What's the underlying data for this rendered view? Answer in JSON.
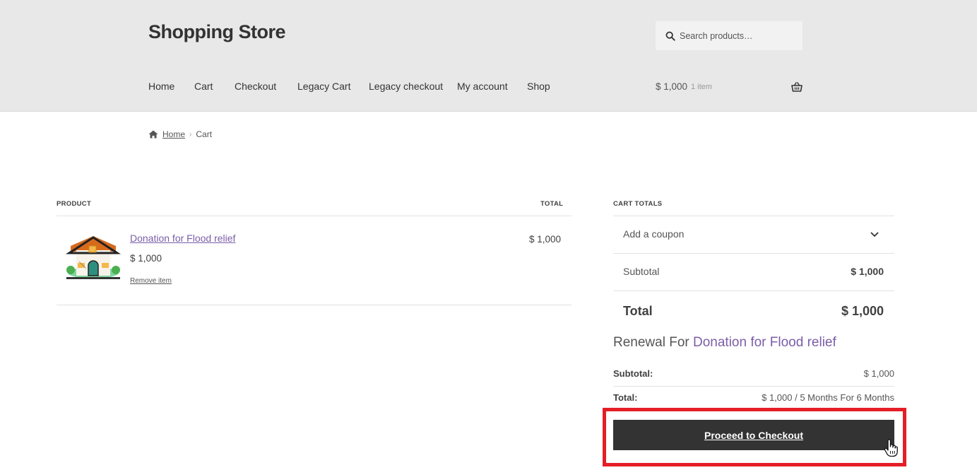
{
  "header": {
    "site_title": "Shopping Store",
    "search": {
      "placeholder": "Search products…"
    },
    "nav": [
      "Home",
      "Cart",
      "Checkout",
      "Legacy Cart",
      "Legacy checkout",
      "My account",
      "Shop"
    ],
    "mini_cart": {
      "amount": "$ 1,000",
      "count": "1 item"
    }
  },
  "breadcrumb": {
    "home": "Home",
    "current": "Cart"
  },
  "cart_table": {
    "headers": {
      "product": "PRODUCT",
      "total": "TOTAL"
    },
    "items": [
      {
        "name": "Donation for Flood relief",
        "price": "$ 1,000",
        "remove": "Remove item",
        "total": "$ 1,000"
      }
    ]
  },
  "cart_totals": {
    "heading": "CART TOTALS",
    "coupon_label": "Add a coupon",
    "subtotal_label": "Subtotal",
    "subtotal_value": "$ 1,000",
    "total_label": "Total",
    "total_value": "$ 1,000",
    "renewal": {
      "prefix": "Renewal For",
      "product": "Donation for Flood relief",
      "subtotal_label": "Subtotal:",
      "subtotal_value": "$ 1,000",
      "total_label": "Total:",
      "total_value": "$ 1,000 / 5 Months For 6 Months"
    },
    "checkout_button": "Proceed to Checkout"
  },
  "colors": {
    "accent_link": "#7b5ea7",
    "button_bg": "#333333",
    "highlight": "#e41e26",
    "header_bg": "#e8e8e8"
  }
}
